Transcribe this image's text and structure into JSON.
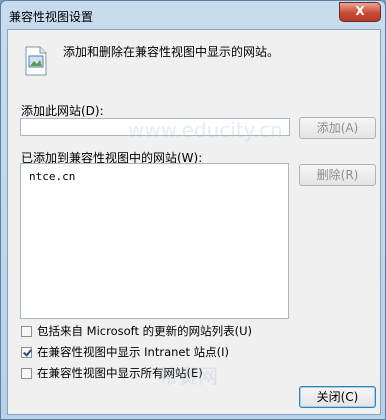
{
  "window": {
    "title": "兼容性视图设置",
    "close_label": "X"
  },
  "info": {
    "text": "添加和删除在兼容性视图中显示的网站。"
  },
  "add_site": {
    "label": "添加此网站(D):",
    "value": "",
    "button_label": "添加(A)"
  },
  "site_list": {
    "label": "已添加到兼容性视图中的网站(W):",
    "items": [
      "ntce.cn"
    ],
    "remove_label": "删除(R)"
  },
  "options": [
    {
      "label": "包括来自 Microsoft 的更新的网站列表(U)",
      "checked": false
    },
    {
      "label": "在兼容性视图中显示 Intranet 站点(I)",
      "checked": true
    },
    {
      "label": "在兼容性视图中显示所有网站(E)",
      "checked": false
    }
  ],
  "close_button": {
    "label": "关闭(C)"
  },
  "watermark": {
    "text": "www.educity.cn",
    "brand": "希赛网"
  }
}
